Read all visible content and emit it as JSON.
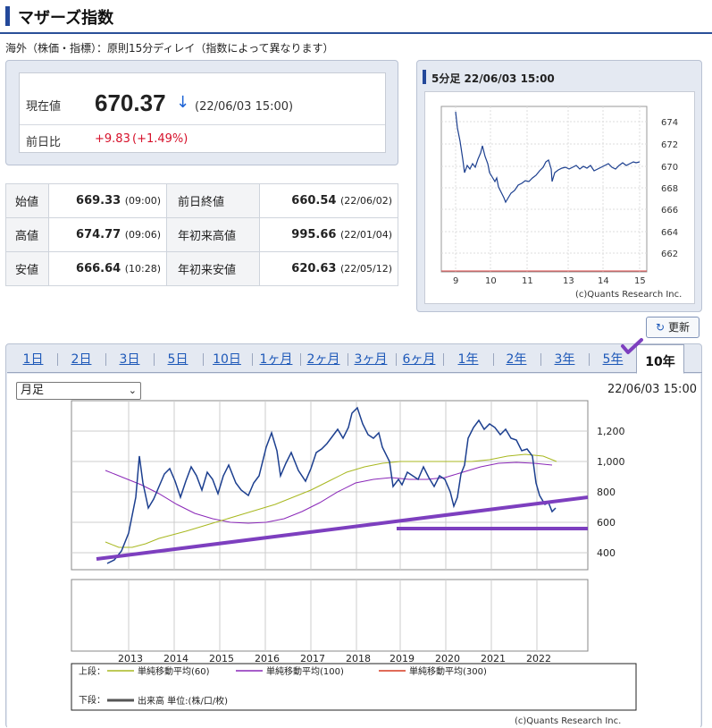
{
  "page_title": "マザーズ指数",
  "note": "海外（株価・指標）：原則15分ディレイ（指数によって異なります）",
  "current": {
    "label": "現在値",
    "value": "670.37",
    "arrow": "↓",
    "time": "(22/06/03 15:00)",
    "prev_label": "前日比",
    "change": "+9.83",
    "change_pct": "(+1.49%)"
  },
  "stats": {
    "open": {
      "label": "始値",
      "value": "669.33",
      "time": "(09:00)"
    },
    "high": {
      "label": "高値",
      "value": "674.77",
      "time": "(09:06)"
    },
    "low": {
      "label": "安値",
      "value": "666.64",
      "time": "(10:28)"
    },
    "prev_close": {
      "label": "前日終値",
      "value": "660.54",
      "time": "(22/06/02)"
    },
    "ytd_high": {
      "label": "年初来高値",
      "value": "995.66",
      "time": "(22/01/04)"
    },
    "ytd_low": {
      "label": "年初来安値",
      "value": "620.63",
      "time": "(22/05/12)"
    }
  },
  "mini_chart": {
    "title": "5分足 22/06/03 15:00",
    "credit": "(c)Quants Research Inc.",
    "xticks": [
      "9",
      "10",
      "11",
      "13",
      "14",
      "15"
    ],
    "yticks": [
      "674",
      "672",
      "670",
      "668",
      "666",
      "664",
      "662"
    ]
  },
  "refresh_label": "更新",
  "tabs": [
    "1日",
    "2日",
    "3日",
    "5日",
    "10日",
    "1ヶ月",
    "2ヶ月",
    "3ヶ月",
    "6ヶ月",
    "1年",
    "2年",
    "3年",
    "5年",
    "10年"
  ],
  "active_tab": "10年",
  "period_select": {
    "value": "月足"
  },
  "chart_time": "22/06/03 15:00",
  "chart_data": {
    "type": "line",
    "x": [
      "2013",
      "2014",
      "2015",
      "2016",
      "2017",
      "2018",
      "2019",
      "2020",
      "2021",
      "2022"
    ],
    "yticks": [
      "1,200",
      "1,000",
      "800",
      "600",
      "400"
    ],
    "ylim": [
      330,
      1350
    ]
  },
  "legend": {
    "upper_label": "上段：",
    "lower_label": "下段：",
    "ma60": "単純移動平均(60)",
    "ma100": "単純移動平均(100)",
    "ma300": "単純移動平均(300)",
    "volume": "出来高 単位:(株/口/枚)",
    "colors": {
      "ma60": "#a8b820",
      "ma100": "#8a28b8",
      "ma300": "#d63a20"
    }
  },
  "credit": "(c)Quants Research Inc."
}
